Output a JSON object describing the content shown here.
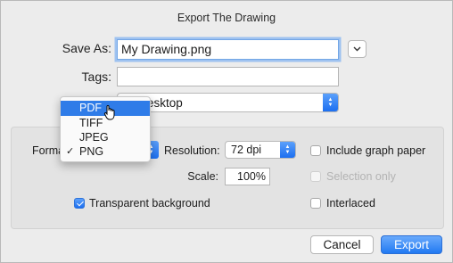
{
  "dialog": {
    "title": "Export The Drawing"
  },
  "save_as": {
    "label": "Save As:",
    "value": "My Drawing.png"
  },
  "tags": {
    "label": "Tags:",
    "value": ""
  },
  "where": {
    "value_visible": "esktop"
  },
  "format": {
    "label_visible": "Forma",
    "menu_items": [
      "PDF",
      "TIFF",
      "JPEG",
      "PNG"
    ],
    "highlighted": "PDF",
    "checked": "PNG",
    "check_glyph": "✓"
  },
  "resolution": {
    "label": "Resolution:",
    "value": "72 dpi"
  },
  "scale": {
    "label": "Scale:",
    "value": "100%"
  },
  "options": {
    "include_graph_paper": {
      "label": "Include graph paper",
      "checked": false,
      "enabled": true
    },
    "selection_only": {
      "label": "Selection only",
      "checked": false,
      "enabled": false
    },
    "transparent_background": {
      "label": "Transparent background",
      "checked": true,
      "enabled": true
    },
    "interlaced": {
      "label": "Interlaced",
      "checked": false,
      "enabled": true
    }
  },
  "buttons": {
    "cancel": "Cancel",
    "export": "Export"
  },
  "colors": {
    "accent": "#2f7ce8",
    "focus_ring": "#9ec2f0",
    "window_bg": "#ececec"
  }
}
